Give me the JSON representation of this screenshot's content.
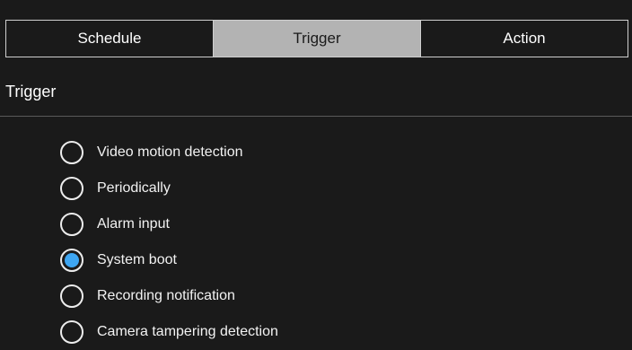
{
  "tabs": [
    {
      "label": "Schedule",
      "active": false
    },
    {
      "label": "Trigger",
      "active": true
    },
    {
      "label": "Action",
      "active": false
    }
  ],
  "section": {
    "title": "Trigger"
  },
  "trigger_options": [
    {
      "label": "Video motion detection",
      "selected": false
    },
    {
      "label": "Periodically",
      "selected": false
    },
    {
      "label": "Alarm input",
      "selected": false
    },
    {
      "label": "System boot",
      "selected": true
    },
    {
      "label": "Recording notification",
      "selected": false
    },
    {
      "label": "Camera tampering detection",
      "selected": false
    }
  ],
  "colors": {
    "background": "#1a1a1a",
    "active_tab": "#b3b3b3",
    "radio_selected": "#3ea6f2",
    "text": "#f2f2f2"
  }
}
